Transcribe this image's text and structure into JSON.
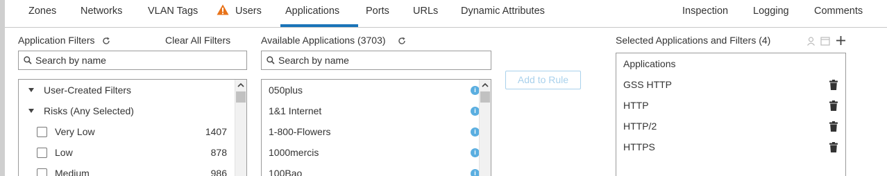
{
  "tabs": [
    {
      "label": "Zones"
    },
    {
      "label": "Networks"
    },
    {
      "label": "VLAN Tags"
    },
    {
      "label": "Users",
      "icon": "warning-icon"
    },
    {
      "label": "Applications",
      "active": true
    },
    {
      "label": "Ports"
    },
    {
      "label": "URLs"
    },
    {
      "label": "Dynamic Attributes"
    },
    {
      "label": "Inspection"
    },
    {
      "label": "Logging"
    },
    {
      "label": "Comments"
    }
  ],
  "colors": {
    "accent": "#1a74b8",
    "warning": "#e8731a",
    "info": "#5aaee0",
    "disabled_button": "#a9d1ec"
  },
  "filters": {
    "title": "Application Filters",
    "clear_all": "Clear All Filters",
    "search_placeholder": "Search by name",
    "items": [
      {
        "type": "group",
        "label": "User-Created Filters"
      },
      {
        "type": "group",
        "label": "Risks (Any Selected)"
      },
      {
        "type": "option",
        "label": "Very Low",
        "count": "1407"
      },
      {
        "type": "option",
        "label": "Low",
        "count": "878"
      },
      {
        "type": "option",
        "label": "Medium",
        "count": "986"
      }
    ]
  },
  "available": {
    "title": "Available Applications (3703)",
    "search_placeholder": "Search by name",
    "items": [
      "050plus",
      "1&1 Internet",
      "1-800-Flowers",
      "1000mercis",
      "100Bao"
    ]
  },
  "add_button": "Add to Rule",
  "selected": {
    "title": "Selected Applications and Filters (4)",
    "header": "Applications",
    "items": [
      "GSS HTTP",
      "HTTP",
      "HTTP/2",
      "HTTPS"
    ]
  }
}
